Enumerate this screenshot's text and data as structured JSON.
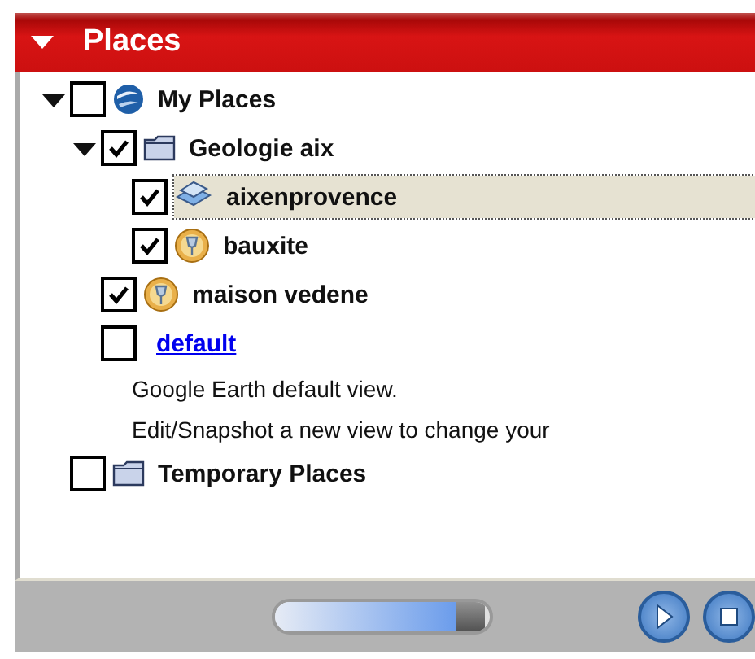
{
  "panel": {
    "title": "Places",
    "expanded": true
  },
  "tree": [
    {
      "kind": "globe",
      "label": "My Places",
      "checked": false,
      "selected": false,
      "expanded": true,
      "children": [
        {
          "kind": "folder",
          "label": "Geologie aix",
          "checked": true,
          "selected": false,
          "expanded": true,
          "children": [
            {
              "kind": "overlay",
              "label": "aixenprovence",
              "checked": true,
              "selected": true
            },
            {
              "kind": "pin",
              "label": "bauxite",
              "checked": true,
              "selected": false
            }
          ]
        },
        {
          "kind": "pin",
          "label": "maison vedene",
          "checked": true,
          "selected": false
        },
        {
          "kind": "link",
          "label": "default",
          "checked": false,
          "selected": false,
          "description": [
            "Google Earth default view.",
            "Edit/Snapshot a new view to change your"
          ]
        }
      ]
    },
    {
      "kind": "folder",
      "label": "Temporary Places",
      "checked": false,
      "selected": false
    }
  ],
  "tour": {
    "level": 0.93
  }
}
